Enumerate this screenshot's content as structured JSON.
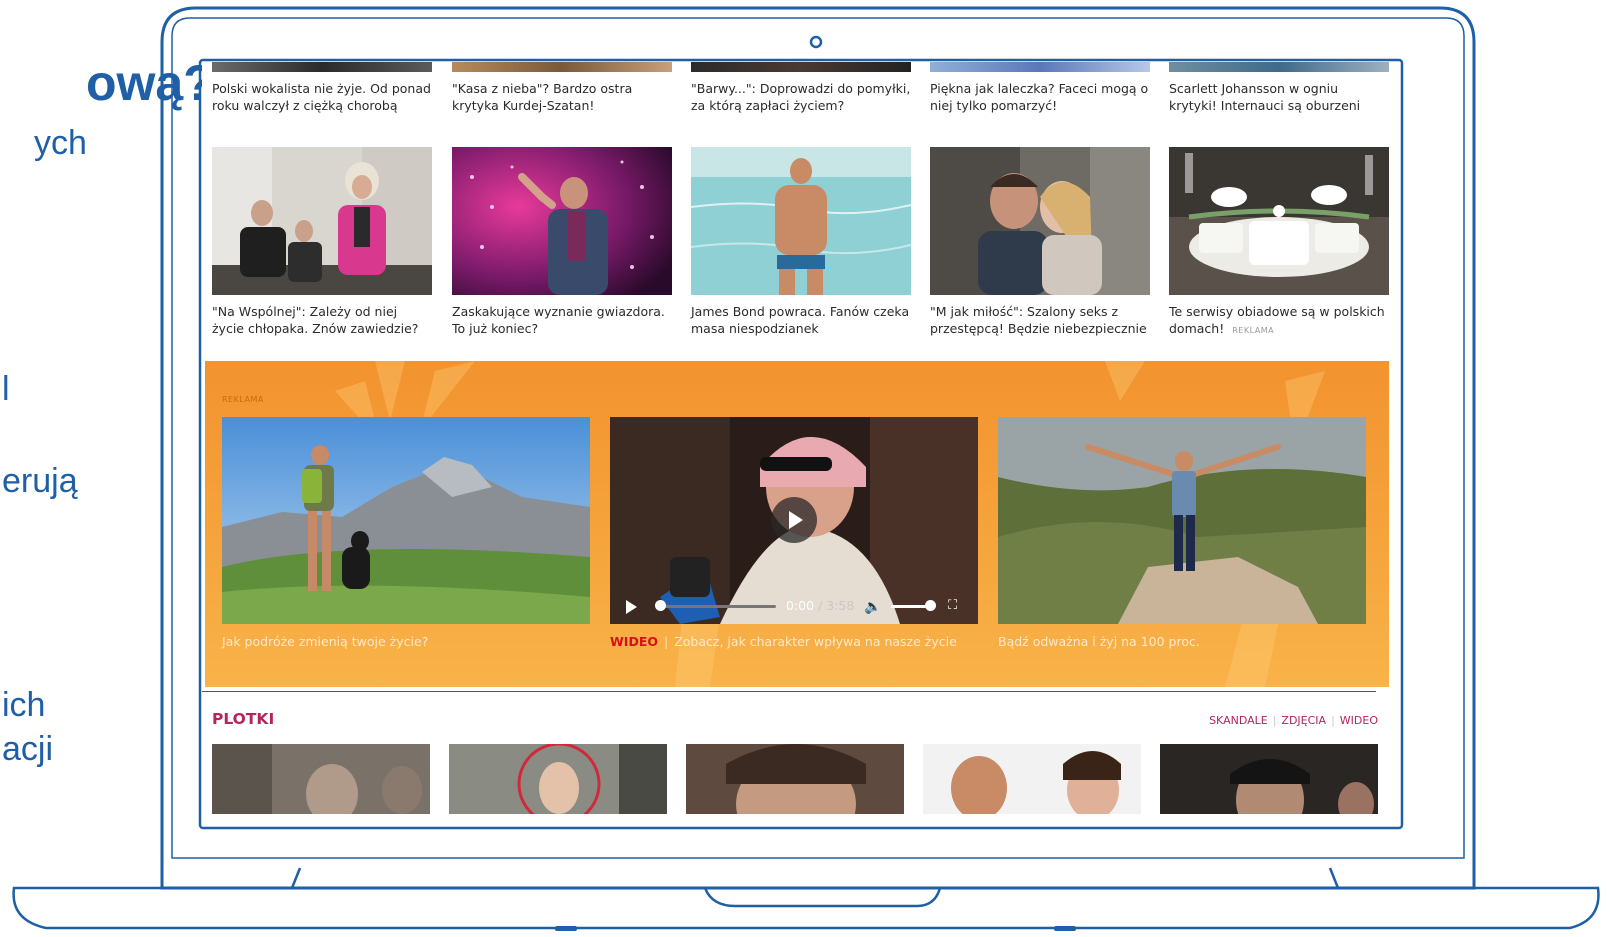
{
  "slide": {
    "title_fragment": "ową?",
    "fragments": [
      "ych",
      "l",
      "erują",
      "ich",
      "acji"
    ]
  },
  "articles_top": [
    {
      "title": "Polski wokalista nie żyje. Od ponad roku walczył z ciężką chorobą"
    },
    {
      "title": "\"Kasa z nieba\"? Bardzo ostra krytyka Kurdej-Szatan!"
    },
    {
      "title": "\"Barwy...\": Doprowadzi do pomyłki, za którą zapłaci życiem?"
    },
    {
      "title": "Piękna jak laleczka? Faceci mogą o niej tylko pomarzyć!"
    },
    {
      "title": "Scarlett Johansson w ogniu krytyki! Internauci są oburzeni"
    }
  ],
  "articles_mid": [
    {
      "title": "\"Na Wspólnej\": Zależy od niej życie chłopaka. Znów zawiedzie?"
    },
    {
      "title": "Zaskakujące wyznanie gwiazdora. To już koniec?"
    },
    {
      "title": "James Bond powraca. Fanów czeka masa niespodzianek"
    },
    {
      "title": "\"M jak miłość\": Szalony seks z przestępcą! Będzie niebezpiecznie"
    },
    {
      "title": "Te serwisy obiadowe są w polskich domach!",
      "ad_label": "REKLAMA"
    }
  ],
  "promo": {
    "ad_label": "REKLAMA",
    "cards": [
      {
        "caption": "Jak podróże zmienią twoje życie?"
      },
      {
        "tag": "WIDEO",
        "separator": "|",
        "caption": "Zobacz, jak charakter wpływa na nasze życie"
      },
      {
        "caption": "Bądź odważna i żyj na 100 proc."
      }
    ],
    "video": {
      "current_time": "0:00",
      "separator": "/",
      "duration": "3:58",
      "progress": 0,
      "volume": 0.9
    }
  },
  "plotki": {
    "title": "PLOTKI",
    "links": [
      "SKANDALE",
      "ZDJĘCIA",
      "WIDEO"
    ]
  },
  "colors": {
    "laptop_outline": "#1f5fa6",
    "promo_orange": "#f39434",
    "plotki_accent": "#b4245e",
    "video_tag": "#d6101a"
  }
}
